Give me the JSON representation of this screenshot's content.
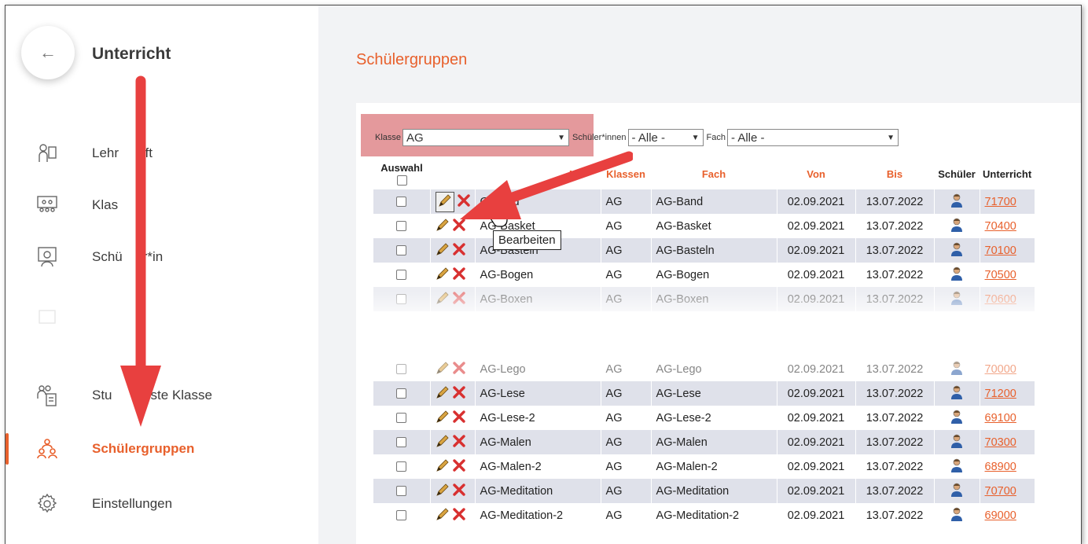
{
  "sidebar": {
    "back_icon": "arrow-left-icon",
    "title": "Unterricht",
    "items": [
      {
        "label": "Lehrkraft",
        "icon": "teacher-icon"
      },
      {
        "label": "Klasse",
        "icon": "classroom-icon"
      },
      {
        "label": "Schüler*in",
        "icon": "student-screen-icon"
      },
      {
        "label": "",
        "icon": "faded-icon"
      },
      {
        "label": "Stundenliste Klasse",
        "icon": "class-list-icon"
      },
      {
        "label": "Schülergruppen",
        "icon": "student-groups-icon"
      },
      {
        "label": "Einstellungen",
        "icon": "gear-icon"
      }
    ],
    "visible_labels": {
      "lehrkraft_a": "Lehr",
      "lehrkraft_b": "aft",
      "klasse": "Klas",
      "schueler_a": "Schü",
      "schueler_b": "r*in",
      "stundenliste_a": "Stu",
      "stundenliste_b": "nliste Klasse",
      "schuelergruppen": "Schülergruppen",
      "einstellungen": "Einstellungen"
    }
  },
  "main": {
    "page_title": "Schülergruppen",
    "filters": {
      "klasse_label": "Klasse",
      "klasse_value": "AG",
      "schueler_label": "Schüler*innen",
      "schueler_value": "- Alle -",
      "fach_label": "Fach",
      "fach_value": "- Alle -"
    },
    "table": {
      "headers": {
        "auswahl": "Auswahl",
        "name": "N",
        "klassen": "Klassen",
        "fach": "Fach",
        "von": "Von",
        "bis": "Bis",
        "schueler": "Schüler",
        "unterricht": "Unterricht"
      },
      "rows": [
        {
          "name": "G-Band",
          "klasse": "AG",
          "fach": "AG-Band",
          "von": "02.09.2021",
          "bis": "13.07.2022",
          "unterricht": "71700"
        },
        {
          "name": "AG-Basket",
          "klasse": "AG",
          "fach": "AG-Basket",
          "von": "02.09.2021",
          "bis": "13.07.2022",
          "unterricht": "70400"
        },
        {
          "name": "AG-Basteln",
          "klasse": "AG",
          "fach": "AG-Basteln",
          "von": "02.09.2021",
          "bis": "13.07.2022",
          "unterricht": "70100"
        },
        {
          "name": "AG-Bogen",
          "klasse": "AG",
          "fach": "AG-Bogen",
          "von": "02.09.2021",
          "bis": "13.07.2022",
          "unterricht": "70500"
        },
        {
          "name": "AG-Boxen",
          "klasse": "AG",
          "fach": "AG-Boxen",
          "von": "02.09.2021",
          "bis": "13.07.2022",
          "unterricht": "70600"
        },
        {
          "name": "AG-Lego",
          "klasse": "AG",
          "fach": "AG-Lego",
          "von": "02.09.2021",
          "bis": "13.07.2022",
          "unterricht": "70000"
        },
        {
          "name": "AG-Lese",
          "klasse": "AG",
          "fach": "AG-Lese",
          "von": "02.09.2021",
          "bis": "13.07.2022",
          "unterricht": "71200"
        },
        {
          "name": "AG-Lese-2",
          "klasse": "AG",
          "fach": "AG-Lese-2",
          "von": "02.09.2021",
          "bis": "13.07.2022",
          "unterricht": "69100"
        },
        {
          "name": "AG-Malen",
          "klasse": "AG",
          "fach": "AG-Malen",
          "von": "02.09.2021",
          "bis": "13.07.2022",
          "unterricht": "70300"
        },
        {
          "name": "AG-Malen-2",
          "klasse": "AG",
          "fach": "AG-Malen-2",
          "von": "02.09.2021",
          "bis": "13.07.2022",
          "unterricht": "68900"
        },
        {
          "name": "AG-Meditation",
          "klasse": "AG",
          "fach": "AG-Meditation",
          "von": "02.09.2021",
          "bis": "13.07.2022",
          "unterricht": "70700"
        },
        {
          "name": "AG-Meditation-2",
          "klasse": "AG",
          "fach": "AG-Meditation-2",
          "von": "02.09.2021",
          "bis": "13.07.2022",
          "unterricht": "69000"
        }
      ]
    },
    "tooltip": "Bearbeiten"
  },
  "colors": {
    "accent": "#e8602c",
    "row_alt": "#dfe1ea",
    "arrow": "#e8403f",
    "highlight": "#cd464b"
  }
}
